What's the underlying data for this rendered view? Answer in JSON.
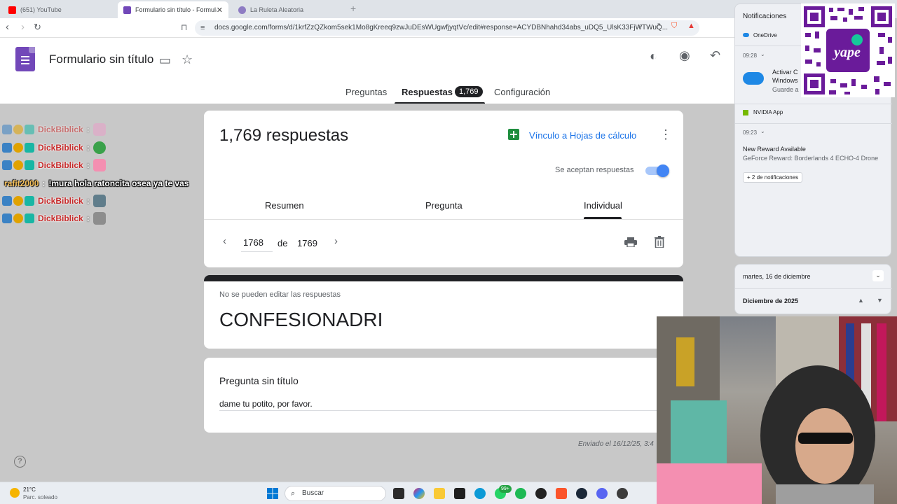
{
  "browser": {
    "tabs": [
      {
        "title": "(651) YouTube",
        "color": "#ff0000"
      },
      {
        "title": "Formulario sin título - Formulario",
        "color": "#7248b9"
      },
      {
        "title": "La Ruleta Aleatoria",
        "color": "#8e7cc3"
      }
    ],
    "url": "docs.google.com/forms/d/1krfZzQZkom5sek1Mo8gKreeq9zwJuDEsWUgwfjyqtVc/edit#response=ACYDBNhahd34abs_uDQ5_UlsK33FjWTWuQ..."
  },
  "forms_header": {
    "title": "Formulario sin título",
    "tabs": {
      "preguntas": "Preguntas",
      "respuestas": "Respuestas",
      "respuestas_badge": "1,769",
      "configuracion": "Configuración"
    }
  },
  "responses": {
    "count_label": "1,769 respuestas",
    "sheets_link": "Vínculo a Hojas de cálculo",
    "accepting_label": "Se aceptan respuestas",
    "accepting": true,
    "subtabs": {
      "summary": "Resumen",
      "question": "Pregunta",
      "individual": "Individual"
    },
    "pager": {
      "current": "1768",
      "of_label": "de",
      "total": "1769"
    }
  },
  "response_card": {
    "notice": "No se pueden editar las respuestas",
    "title": "CONFESIONADRI"
  },
  "question_card": {
    "title": "Pregunta sin título",
    "answer": "dame tu potito, por favor."
  },
  "submitted_text": "Enviado el 16/12/25, 3:4",
  "chat": [
    {
      "user": "DickBiblick",
      "sep": ":",
      "msg": "",
      "emote_color": "#e9a0c8"
    },
    {
      "user": "DickBiblick",
      "sep": ":",
      "msg": "",
      "emote_color": "#3aa14a"
    },
    {
      "user": "DickBiblick",
      "sep": ":",
      "msg": "",
      "emote_color": "#f48fb1"
    },
    {
      "user": "rafit2000",
      "sep": ":",
      "msg": "!mura hola ratoncita osea ya te vas",
      "emote_color": ""
    },
    {
      "user": "DickBiblick",
      "sep": ":",
      "msg": "",
      "emote_color": "#607d8b"
    },
    {
      "user": "DickBiblick",
      "sep": ":",
      "msg": "",
      "emote_color": "#8d8d8d"
    }
  ],
  "notifications": {
    "title": "Notificaciones",
    "onedrive_app": "OneDrive",
    "onedrive_time": "09:28",
    "onedrive_line1": "Activar C",
    "onedrive_line2": "Windows",
    "onedrive_line3": "Guarde a",
    "nvidia_app": "NVIDIA App",
    "nvidia_time": "09:23",
    "nvidia_title": "New Reward Available",
    "nvidia_body": "GeForce Reward: Borderlands 4 ECHO-4 Drone",
    "more": "+ 2 de notificaciones",
    "qr_label": "yape"
  },
  "calendar": {
    "date": "martes, 16 de diciembre",
    "month": "Diciembre de 2025"
  },
  "taskbar": {
    "weather_temp": "21°C",
    "weather_desc": "Parc. soleado",
    "search": "Buscar",
    "whatsapp_badge": "99+"
  }
}
